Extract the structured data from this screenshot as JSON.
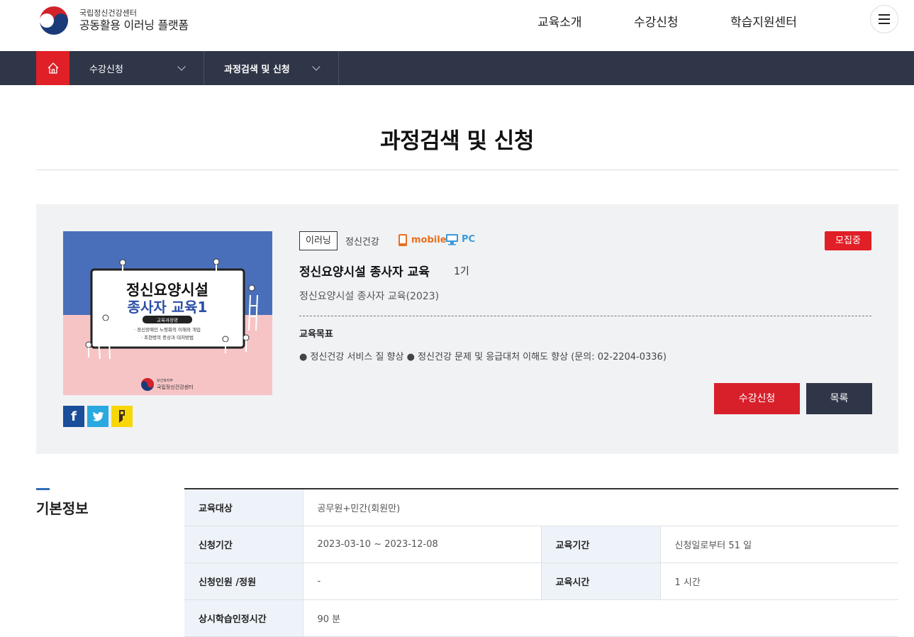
{
  "header": {
    "org_sub": "국립정신건강센터",
    "org_main": "공동활용 이러닝 플랫폼",
    "nav": [
      "교육소개",
      "수강신청",
      "학습지원센터"
    ]
  },
  "subnav": {
    "level1": "수강신청",
    "level2": "과정검색 및 신청"
  },
  "page": {
    "title": "과정검색 및 신청"
  },
  "course": {
    "thumb": {
      "title1": "정신요양시설",
      "title2": "종사자 교육1",
      "badge": "교육과정명",
      "line1": "· 정신장애인 노령화의 이해와 개입",
      "line2": "· 조현병의 증상과 대처방법",
      "logo_sub": "보건복지부",
      "logo_main": "국립정신건강센터"
    },
    "type_tag": "이러닝",
    "category": "정신건강",
    "mobile_label": "mobile",
    "pc_label": "PC",
    "status": "모집중",
    "title": "정신요양시설 종사자 교육",
    "generation": "1기",
    "subtitle": "정신요양시설 종사자 교육(2023)",
    "goal_heading": "교육목표",
    "goal_text": "● 정신건강 서비스 질 향상 ● 정신건강 문제 및 응급대처 이해도 향상 (문의: 02-2204-0336)",
    "apply_label": "수강신청",
    "list_label": "목록"
  },
  "basic": {
    "heading": "기본정보",
    "target_label": "교육대상",
    "target_value": "공무원+민간(회원만)",
    "apply_period_label": "신청기간",
    "apply_period_value": "2023-03-10 ~ 2023-12-08",
    "edu_period_label": "교육기간",
    "edu_period_value": "신청일로부터 51 일",
    "applicants_label": "신청인원 /정원",
    "applicants_value": "-",
    "edu_time_label": "교육시간",
    "edu_time_value": "1 시간",
    "credit_label": "상시학습인정시간",
    "credit_value": "90 분"
  },
  "colors": {
    "accent_red": "#e01f26",
    "navy": "#2f3648",
    "thumb_blue": "#4a6fba",
    "thumb_pink": "#f7c4c6"
  }
}
